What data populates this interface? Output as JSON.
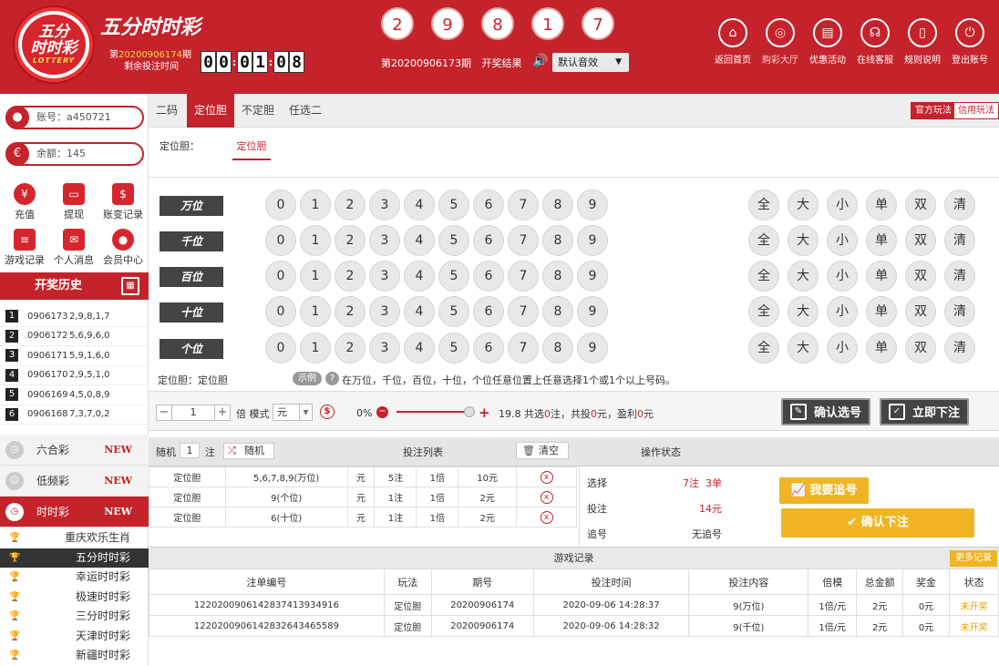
{
  "header": {
    "logo": {
      "line1": "五分",
      "line2": "时时彩",
      "line3": "LOTTERY"
    },
    "brand": "五分时时彩",
    "issue_prefix": "第",
    "issue_no": "20200906174",
    "issue_suffix": "期",
    "countdown_label": "剩余投注时间",
    "countdown": [
      "0",
      "0",
      "0",
      "1",
      "0",
      "8"
    ],
    "balls": [
      "2",
      "9",
      "8",
      "1",
      "7"
    ],
    "last_issue": "第20200906173期",
    "result_label": "开奖结果",
    "sound": "默认音效",
    "nav": [
      {
        "label": "返回首页",
        "icon": "⌂"
      },
      {
        "label": "购彩大厅",
        "icon": "◎"
      },
      {
        "label": "优惠活动",
        "icon": "▤"
      },
      {
        "label": "在线客服",
        "icon": "☊"
      },
      {
        "label": "规则说明",
        "icon": "▯"
      },
      {
        "label": "登出账号",
        "icon": "⏻"
      }
    ]
  },
  "sidebar": {
    "account": "账号：a450721",
    "balance": "余额：145",
    "functions": [
      {
        "label": "充值",
        "icon": "¥"
      },
      {
        "label": "提现",
        "icon": "▭"
      },
      {
        "label": "账变记录",
        "icon": "$"
      },
      {
        "label": "游戏记录",
        "icon": "≡"
      },
      {
        "label": "个人消息",
        "icon": "✉"
      },
      {
        "label": "会员中心",
        "icon": "●"
      }
    ],
    "history_title": "开奖历史",
    "history": [
      {
        "n": "1",
        "issue": "0906173",
        "nums": "2,9,8,1,7"
      },
      {
        "n": "2",
        "issue": "0906172",
        "nums": "5,6,9,6,0"
      },
      {
        "n": "3",
        "issue": "0906171",
        "nums": "5,9,1,6,0"
      },
      {
        "n": "4",
        "issue": "0906170",
        "nums": "2,9,5,1,0"
      },
      {
        "n": "5",
        "issue": "0906169",
        "nums": "4,5,0,8,9"
      },
      {
        "n": "6",
        "issue": "0906168",
        "nums": "7,3,7,0,2"
      }
    ],
    "categories": [
      {
        "label": "六合彩",
        "badge": "NEW"
      },
      {
        "label": "低频彩",
        "badge": "NEW"
      },
      {
        "label": "时时彩",
        "badge": "NEW"
      }
    ],
    "games": [
      "重庆欢乐生肖",
      "五分时时彩",
      "幸运时时彩",
      "极速时时彩",
      "三分时时彩",
      "天津时时彩",
      "新疆时时彩"
    ]
  },
  "main": {
    "tabs": [
      "二码",
      "定位胆",
      "不定胆",
      "任选二"
    ],
    "mode_official": "官方玩法",
    "mode_credit": "信用玩法",
    "sub_label": "定位胆：",
    "sub_tab": "定位胆",
    "positions": [
      "万位",
      "千位",
      "百位",
      "十位",
      "个位"
    ],
    "digits": [
      "0",
      "1",
      "2",
      "3",
      "4",
      "5",
      "6",
      "7",
      "8",
      "9"
    ],
    "quick": [
      "全",
      "大",
      "小",
      "单",
      "双",
      "清"
    ],
    "hint_label": "定位胆：定位胆",
    "hint_example": "示例",
    "hint_q": "?",
    "hint_text": "在万位，千位，百位，十位，个位任意位置上任意选择1个或1个以上号码。",
    "multiple": "1",
    "multiple_label": "倍 模式",
    "unit": "元",
    "rebate": "0%",
    "summary": {
      "odds": "19.8",
      "pre1": "共选",
      "count": "0",
      "mid1": "注，共投",
      "amount": "0",
      "mid2": "元，盈利",
      "profit": "0",
      "post": "元"
    },
    "confirm_select": "确认选号",
    "bet_now": "立即下注",
    "random_label": "随机",
    "random_count": "1",
    "random_unit": "注",
    "random_btn": "随机",
    "list_title": "投注列表",
    "clear_btn": "清空",
    "op_title": "操作状态",
    "bets": [
      {
        "type": "定位胆",
        "content": "5,6,7,8,9(万位)",
        "unit": "元",
        "count": "5注",
        "mult": "1倍",
        "amount": "10元"
      },
      {
        "type": "定位胆",
        "content": "9(个位)",
        "unit": "元",
        "count": "1注",
        "mult": "1倍",
        "amount": "2元"
      },
      {
        "type": "定位胆",
        "content": "6(十位)",
        "unit": "元",
        "count": "1注",
        "mult": "1倍",
        "amount": "2元"
      }
    ],
    "op": {
      "select_label": "选择",
      "select_val1": "7注",
      "select_val2": "3单",
      "bet_label": "投注",
      "bet_val": "14元",
      "chase_label": "追号",
      "chase_val": "无追号"
    },
    "chase_btn": "我要追号",
    "confirm_bet": "确认下注",
    "records_title": "游戏记录",
    "more_records": "更多记录",
    "record_headers": [
      "注单编号",
      "玩法",
      "期号",
      "投注时间",
      "投注内容",
      "倍模",
      "总金额",
      "奖金",
      "状态"
    ],
    "records": [
      [
        "12202009061428374139349​16",
        "定位胆",
        "20200906174",
        "2020-09-06 14:28:37",
        "9(万位)",
        "1倍/元",
        "2元",
        "0元",
        "未开奖"
      ],
      [
        "12202009061428326434655​89",
        "定位胆",
        "20200906174",
        "2020-09-06 14:28:32",
        "9(千位)",
        "1倍/元",
        "2元",
        "0元",
        "未开奖"
      ]
    ]
  }
}
